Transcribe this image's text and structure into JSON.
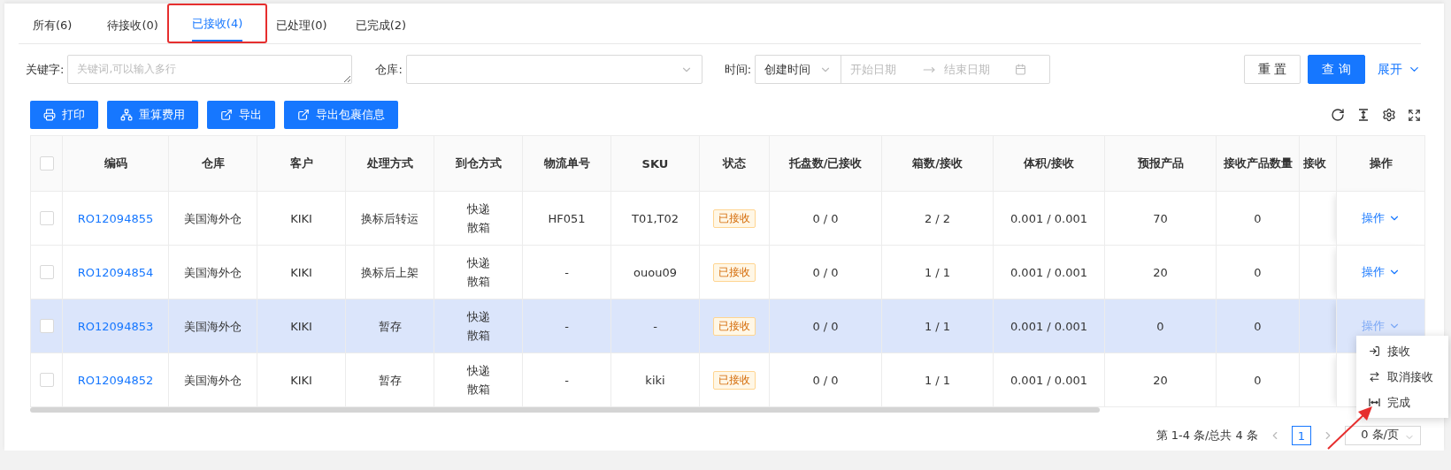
{
  "tabs": [
    {
      "label": "所有(6)",
      "selected": false
    },
    {
      "label": "待接收(0)",
      "selected": false
    },
    {
      "label": "已接收(4)",
      "selected": true,
      "highlighted": true
    },
    {
      "label": "已处理(0)",
      "selected": false
    },
    {
      "label": "已完成(2)",
      "selected": false
    }
  ],
  "filters": {
    "keyword": {
      "label": "关键字:",
      "placeholder": "关键词,可以输入多行"
    },
    "warehouse": {
      "label": "仓库:"
    },
    "time": {
      "label": "时间:",
      "type": "创建时间",
      "start_placeholder": "开始日期",
      "end_placeholder": "结束日期"
    }
  },
  "filter_buttons": {
    "reset": "重 置",
    "query": "查 询",
    "expand": "展开"
  },
  "action_buttons": [
    {
      "label": "打印",
      "kind": "print"
    },
    {
      "label": "重算费用",
      "kind": "recalc"
    },
    {
      "label": "导出",
      "kind": "export"
    },
    {
      "label": "导出包裹信息",
      "kind": "export"
    }
  ],
  "table": {
    "header_checked": false,
    "columns": [
      "编码",
      "仓库",
      "客户",
      "处理方式",
      "到仓方式",
      "物流单号",
      "SKU",
      "状态",
      "托盘数/已接收",
      "箱数/接收",
      "体积/接收",
      "预报产品",
      "接收产品数量",
      "接收",
      "操作"
    ],
    "rows": [
      {
        "checked": false,
        "selected": false,
        "code": "RO12094855",
        "warehouse": "美国海外仓",
        "customer": "KIKI",
        "handling": "换标后转运",
        "arrival": [
          "快递",
          "散箱"
        ],
        "tracking": "HF051",
        "sku": "T01,T02",
        "status": "已接收",
        "pallets": "0 / 0",
        "boxes": "2 / 2",
        "volume": "0.001 / 0.001",
        "forecast": "70",
        "received_qty": "0",
        "action": "操作"
      },
      {
        "checked": false,
        "selected": false,
        "code": "RO12094854",
        "warehouse": "美国海外仓",
        "customer": "KIKI",
        "handling": "换标后上架",
        "arrival": [
          "快递",
          "散箱"
        ],
        "tracking": "-",
        "sku": "ouou09",
        "status": "已接收",
        "pallets": "0 / 0",
        "boxes": "1 / 1",
        "volume": "0.001 / 0.001",
        "forecast": "20",
        "received_qty": "0",
        "action": "操作"
      },
      {
        "checked": false,
        "selected": true,
        "code": "RO12094853",
        "warehouse": "美国海外仓",
        "customer": "KIKI",
        "handling": "暂存",
        "arrival": [
          "快递",
          "散箱"
        ],
        "tracking": "-",
        "sku": "-",
        "status": "已接收",
        "pallets": "0 / 0",
        "boxes": "1 / 1",
        "volume": "0.001 / 0.001",
        "forecast": "0",
        "received_qty": "0",
        "action": "操作"
      },
      {
        "checked": false,
        "selected": false,
        "code": "RO12094852",
        "warehouse": "美国海外仓",
        "customer": "KIKI",
        "handling": "暂存",
        "arrival": [
          "快递",
          "散箱"
        ],
        "tracking": "-",
        "sku": "kiki",
        "status": "已接收",
        "pallets": "0 / 0",
        "boxes": "1 / 1",
        "volume": "0.001 / 0.001",
        "forecast": "20",
        "received_qty": "0"
      }
    ]
  },
  "pagination": {
    "summary": "第 1-4 条/总共 4 条",
    "pages": [
      {
        "label": "1",
        "selected": true
      }
    ],
    "page_size": "0 条/页"
  },
  "dropdown_menu": {
    "items": [
      {
        "label": "接收",
        "kind": "receive"
      },
      {
        "label": "取消接收",
        "kind": "cancel"
      },
      {
        "label": "完成",
        "kind": "complete"
      }
    ]
  },
  "annotation": {
    "arrow": true
  }
}
